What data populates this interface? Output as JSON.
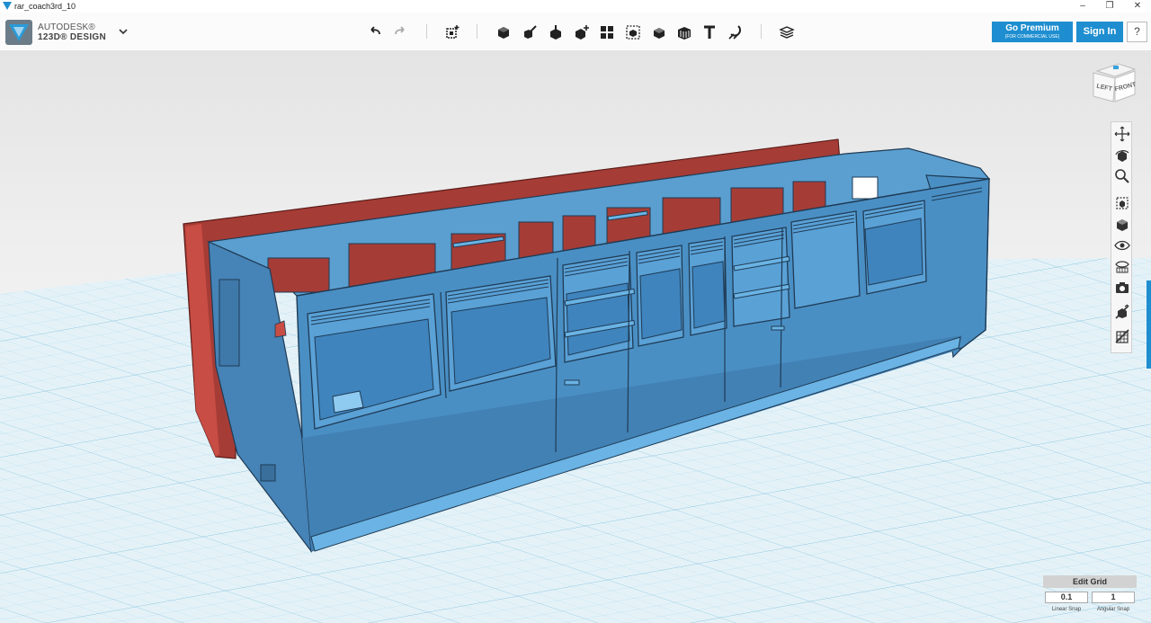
{
  "window": {
    "title": "rar_coach3rd_10",
    "controls": [
      "–",
      "❐",
      "✕"
    ]
  },
  "brand": {
    "company": "AUTODESK®",
    "product": "123D® DESIGN"
  },
  "toolbar": {
    "tools": [
      "undo-icon",
      "redo-icon",
      "transform-icon",
      "primitives-icon",
      "sketch-icon",
      "construct-icon",
      "modify-icon",
      "pattern-icon",
      "group-icon",
      "combine-icon",
      "measure-icon",
      "text-icon",
      "snap-icon",
      "material-icon"
    ]
  },
  "account": {
    "premium_label": "Go Premium",
    "premium_sub": "(FOR COMMERCIAL USE)",
    "signin_label": "Sign In",
    "help_label": "?"
  },
  "viewcube": {
    "left_label": "LEFT",
    "front_label": "FRONT"
  },
  "nav_tools": [
    "pan-icon",
    "orbit-icon",
    "zoom-icon",
    "fit-icon",
    "view-icon",
    "visibility-icon",
    "material-view-icon",
    "camera-icon",
    "hide-sketch-icon",
    "hide-mesh-icon"
  ],
  "grid": {
    "edit_label": "Edit Grid",
    "linear_value": "0.1",
    "linear_label": "Linear Snap",
    "angular_value": "1",
    "angular_label": "Angular Snap"
  },
  "colors": {
    "accent": "#1e8ed0",
    "model_blue": "#4a8fc4",
    "model_red": "#a63c36",
    "grid_line": "#a8d4e8"
  }
}
